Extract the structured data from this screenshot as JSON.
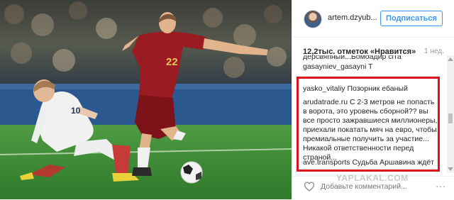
{
  "header": {
    "username": "artem.dzyub...",
    "follow_label": "Подписаться"
  },
  "post": {
    "likes": "12,2тыс. отметок «Нравится»",
    "age": "1 нед."
  },
  "comments": [
    {
      "text": "дерсвяпный...Бомоадир сгга"
    },
    {
      "author": "gasayniev_gasayni",
      "text": "T"
    },
    {
      "author": "yasko_vitaliy",
      "text": "Позорник ебаный"
    },
    {
      "author": "arudatrade.ru",
      "text": "С 2-3 метров не попасть в ворота, это уровень сборной?? вы все просто зажравшиеся миллионеры, приехали покатать мяч на евро, чтобы премиальные получить за участие... Никакой ответственности перед страной..."
    },
    {
      "author": "ave.transports",
      "text": "Судьба Аршавина ждёт"
    }
  ],
  "footer": {
    "comment_placeholder": "Добавьте комментарий...",
    "more_symbol": "···"
  },
  "watermark": "YAPLAKAL.COM",
  "photo": {
    "player_number_red": "22",
    "player_number_white": "10"
  },
  "colors": {
    "accent": "#3897f0",
    "highlight": "#d8141e",
    "pitch": "#3f8a36",
    "russia_kit": "#9b1b22"
  }
}
